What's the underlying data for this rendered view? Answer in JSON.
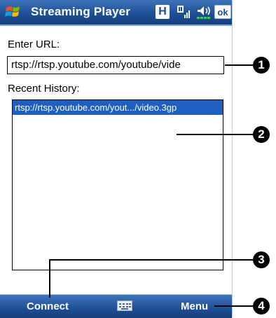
{
  "titlebar": {
    "title": "Streaming Player",
    "h_icon": "H",
    "ok_label": "ok"
  },
  "form": {
    "url_label": "Enter URL:",
    "url_value": "rtsp://rtsp.youtube.com/youtube/vide",
    "history_label": "Recent History:",
    "history_items": [
      "rtsp://rtsp.youtube.com/yout.../video.3gp"
    ]
  },
  "menubar": {
    "left_softkey": "Connect",
    "right_softkey": "Menu"
  },
  "callouts": [
    "1",
    "2",
    "3",
    "4"
  ],
  "colors": {
    "titlebar": "#1f4f97",
    "selection": "#1f5fc2"
  }
}
